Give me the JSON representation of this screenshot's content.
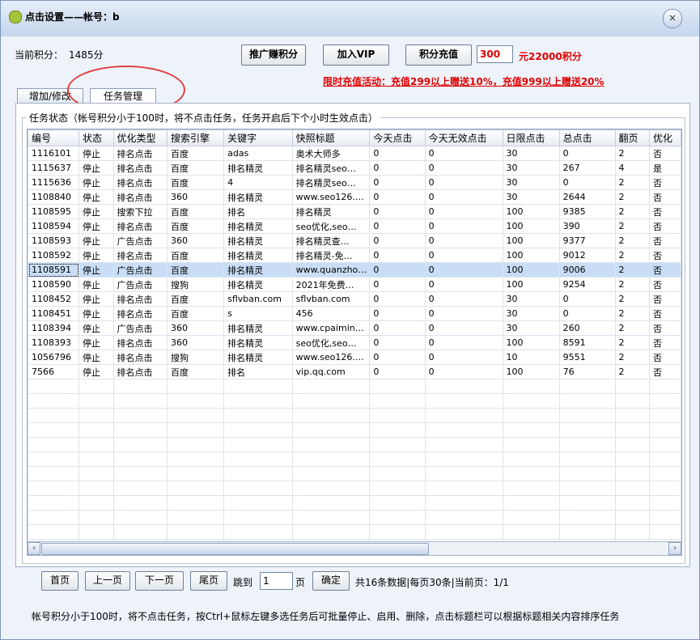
{
  "window": {
    "title": "点击设置——帐号：b",
    "close_glyph": "×"
  },
  "account": {
    "credits_label": "当前积分：",
    "credits_value": "1485分"
  },
  "toolbar": {
    "promote_label": "推广赚积分",
    "vip_label": "加入VIP",
    "recharge_label": "积分充值",
    "amount_value": "300",
    "rate_text": "元22000积分"
  },
  "promo_text": "限时充值活动：充值299以上赠送10%，充值999以上赠送20%",
  "tabs": [
    {
      "label": "增加/修改"
    },
    {
      "label": "任务管理"
    }
  ],
  "group_label": "任务状态（帐号积分小于100时，将不点击任务，任务开启后下个小时生效点击）",
  "table": {
    "columns": [
      "编号",
      "状态",
      "优化类型",
      "搜索引擎",
      "关键字",
      "快照标题",
      "今天点击",
      "今天无效点击",
      "日限点击",
      "总点击",
      "翻页",
      "优化"
    ],
    "rows": [
      [
        "1116101",
        "停止",
        "排名点击",
        "百度",
        "adas",
        "奥术大师多",
        "0",
        "0",
        "30",
        "0",
        "2",
        "否"
      ],
      [
        "1115637",
        "停止",
        "排名点击",
        "百度",
        "排名精灵",
        "排名精灵seo…",
        "0",
        "0",
        "30",
        "267",
        "4",
        "是"
      ],
      [
        "1115636",
        "停止",
        "排名点击",
        "百度",
        "4",
        "排名精灵seo…",
        "0",
        "0",
        "30",
        "0",
        "2",
        "否"
      ],
      [
        "1108840",
        "停止",
        "排名点击",
        "360",
        "排名精灵",
        "www.seo126.…",
        "0",
        "0",
        "30",
        "2644",
        "2",
        "否"
      ],
      [
        "1108595",
        "停止",
        "搜索下拉",
        "百度",
        "排名",
        "排名精灵",
        "0",
        "0",
        "100",
        "9385",
        "2",
        "否"
      ],
      [
        "1108594",
        "停止",
        "排名点击",
        "百度",
        "排名精灵",
        "seo优化,seo…",
        "0",
        "0",
        "100",
        "390",
        "2",
        "否"
      ],
      [
        "1108593",
        "停止",
        "广告点击",
        "360",
        "排名精灵",
        "排名精灵查…",
        "0",
        "0",
        "100",
        "9377",
        "2",
        "否"
      ],
      [
        "1108592",
        "停止",
        "排名点击",
        "百度",
        "排名精灵",
        "排名精灵-免…",
        "0",
        "0",
        "100",
        "9012",
        "2",
        "否"
      ],
      [
        "1108591",
        "停止",
        "广告点击",
        "百度",
        "排名精灵",
        "www.quanzho…",
        "0",
        "0",
        "100",
        "9006",
        "2",
        "否"
      ],
      [
        "1108590",
        "停止",
        "广告点击",
        "搜狗",
        "排名精灵",
        "2021年免费…",
        "0",
        "0",
        "100",
        "9254",
        "2",
        "否"
      ],
      [
        "1108452",
        "停止",
        "排名点击",
        "百度",
        "sflvban.com",
        "sflvban.com",
        "0",
        "0",
        "30",
        "0",
        "2",
        "否"
      ],
      [
        "1108451",
        "停止",
        "排名点击",
        "百度",
        "s",
        "456",
        "0",
        "0",
        "30",
        "0",
        "2",
        "否"
      ],
      [
        "1108394",
        "停止",
        "广告点击",
        "360",
        "排名精灵",
        "www.cpaimin…",
        "0",
        "0",
        "30",
        "260",
        "2",
        "否"
      ],
      [
        "1108393",
        "停止",
        "排名点击",
        "360",
        "排名精灵",
        "seo优化,seo…",
        "0",
        "0",
        "100",
        "8591",
        "2",
        "否"
      ],
      [
        "1056796",
        "停止",
        "排名点击",
        "搜狗",
        "排名精灵",
        "www.seo126.…",
        "0",
        "0",
        "10",
        "9551",
        "2",
        "否"
      ],
      [
        "7566",
        "停止",
        "排名点击",
        "百度",
        "排名",
        "vip.qq.com",
        "0",
        "0",
        "100",
        "76",
        "2",
        "否"
      ]
    ],
    "selected_row": 8,
    "empty_rows": 15
  },
  "pager": {
    "first": "首页",
    "prev": "上一页",
    "next": "下一页",
    "last": "尾页",
    "goto_label": "跳到",
    "page_value": "1",
    "page_unit": "页",
    "confirm": "确定",
    "summary": "共16条数据|每页30条|当前页：1/1"
  },
  "footer_note": "帐号积分小于100时，将不点击任务，按Ctrl+鼠标左键多选任务后可批量停止、启用、删除，点击标题栏可以根据标题相关内容排序任务",
  "scroll": {
    "left_glyph": "‹",
    "right_glyph": "›"
  },
  "colors": {
    "accent_red": "#e00000",
    "selection": "#c9ddf6",
    "annotation_circle": "#e04040"
  }
}
